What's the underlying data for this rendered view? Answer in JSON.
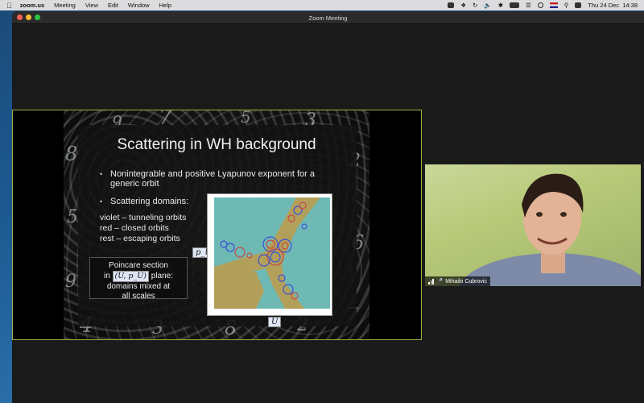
{
  "menubar": {
    "app": "zoom.us",
    "items": [
      "Meeting",
      "View",
      "Edit",
      "Window",
      "Help"
    ],
    "datetime": "Thu 24 Dec  14:38"
  },
  "window": {
    "title": "Zoom Meeting"
  },
  "slide": {
    "title": "Scattering in WH background",
    "bullet1": "Nonintegrable and positive Lyapunov exponent for a generic orbit",
    "bullet2": "Scattering domains:",
    "domain_lines": [
      "violet – tunneling orbits",
      "red – closed orbits",
      "rest – escaping orbits"
    ],
    "note_line1": "Poincare section",
    "note_in": "in",
    "note_math": "(U, p_U)",
    "note_plane": "plane:",
    "note_line3": "domains mixed at",
    "note_line4": "all scales",
    "y_axis_label": "p_U",
    "x_axis_label": "U",
    "decorative_digits": [
      "7",
      "3",
      "8",
      "2",
      "5",
      "6",
      "9",
      "4",
      "3",
      "8",
      "2",
      "7",
      "5",
      "9"
    ]
  },
  "participant": {
    "name": "Mihailo Cubrovic"
  },
  "colors": {
    "share_border": "#a0b040",
    "plot_background": "#6fb9b5",
    "plot_domain": "#b2a05a",
    "tunneling": "#3a4fd8",
    "closed": "#c64a44"
  },
  "icons": {
    "apple": "apple-icon",
    "status": [
      "screen-icon",
      "dropbox-icon",
      "history-icon",
      "volume-icon",
      "bluetooth-icon",
      "battery-icon",
      "wifi-icon",
      "user-icon",
      "flag-icon",
      "search-icon",
      "control-center-icon"
    ],
    "mic": "mic-icon",
    "signal": "signal-icon"
  }
}
